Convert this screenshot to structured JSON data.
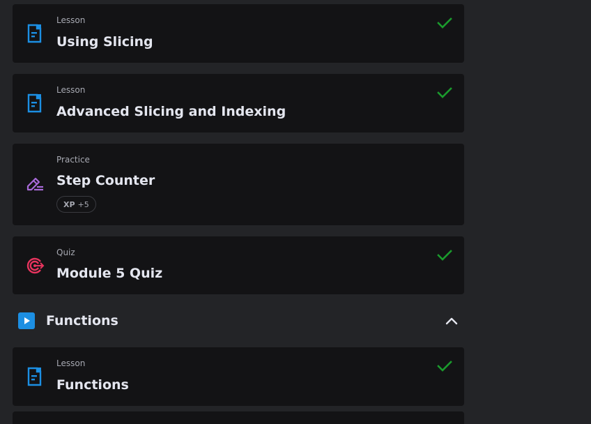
{
  "cards": [
    {
      "type": "Lesson",
      "title": "Using Slicing",
      "completed": true,
      "icon": "document-icon"
    },
    {
      "type": "Lesson",
      "title": "Advanced Slicing and Indexing",
      "completed": true,
      "icon": "document-icon"
    },
    {
      "type": "Practice",
      "title": "Step Counter",
      "completed": false,
      "icon": "pencil-icon",
      "xp": {
        "label": "XP",
        "value": "+5"
      }
    },
    {
      "type": "Quiz",
      "title": "Module 5 Quiz",
      "completed": true,
      "icon": "target-icon"
    }
  ],
  "section": {
    "title": "Functions",
    "expanded": true,
    "icon": "play-icon",
    "cards": [
      {
        "type": "Lesson",
        "title": "Functions",
        "completed": true,
        "icon": "document-icon"
      }
    ]
  },
  "colors": {
    "background": "#232427",
    "card": "#131315",
    "lesson_icon": "#1c8fe3",
    "practice_icon": "#a86ad8",
    "quiz_icon": "#e8345e",
    "check": "#1b9a2d",
    "section_icon": "#1c8fe3"
  }
}
